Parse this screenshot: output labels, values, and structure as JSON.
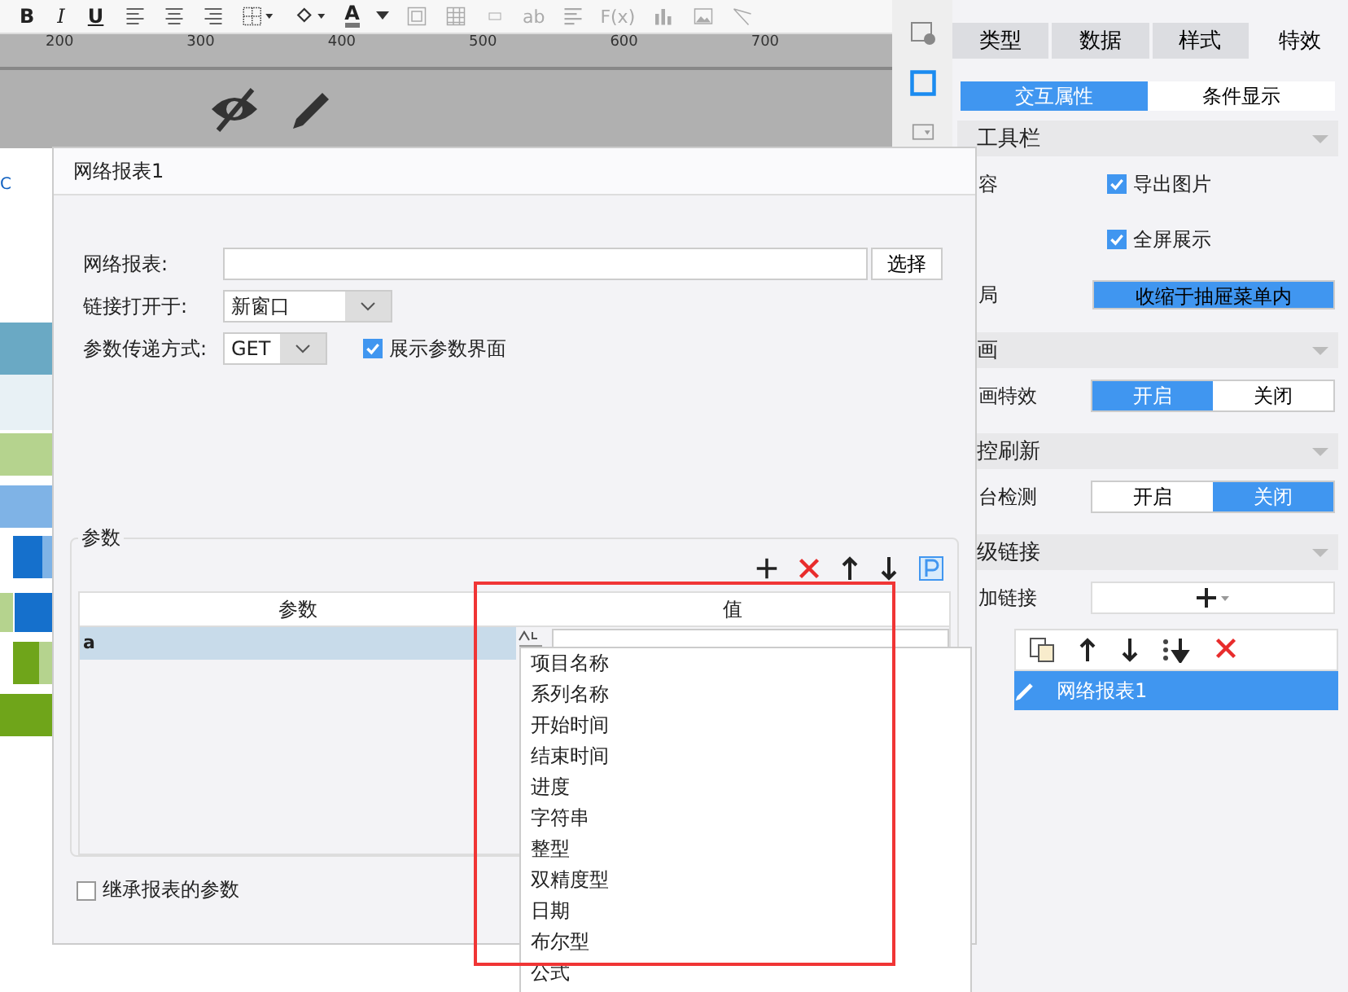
{
  "toolbar": {
    "format": [
      "B",
      "I",
      "U"
    ],
    "font_color": "A",
    "greyed_texts": [
      "ab",
      "F(x)"
    ]
  },
  "ruler": {
    "labels": [
      "200",
      "300",
      "400",
      "500",
      "600",
      "700"
    ]
  },
  "sheet": {
    "cell_text": "C"
  },
  "dialog": {
    "title": "网络报表1",
    "report_field": {
      "label": "网络报表:",
      "button": "选择"
    },
    "open_in": {
      "label": "链接打开于:",
      "value": "新窗口"
    },
    "method": {
      "label": "参数传递方式:",
      "value": "GET"
    },
    "show_params": {
      "label": "展示参数界面",
      "checked": true
    },
    "params": {
      "title": "参数",
      "columns": [
        "参数",
        "值"
      ],
      "rows": [
        {
          "name": "a",
          "selected": true
        }
      ]
    },
    "type_menu": [
      "项目名称",
      "系列名称",
      "开始时间",
      "结束时间",
      "进度",
      "字符串",
      "整型",
      "双精度型",
      "日期",
      "布尔型",
      "公式"
    ],
    "inherit": {
      "label": "继承报表的参数",
      "checked": false
    }
  },
  "panel": {
    "tabs": [
      {
        "label": "类型",
        "selected": false
      },
      {
        "label": "数据",
        "selected": false
      },
      {
        "label": "样式",
        "selected": false
      },
      {
        "label": "特效",
        "selected": true
      }
    ],
    "subtabs": [
      {
        "label": "交互属性",
        "selected": true
      },
      {
        "label": "条件显示",
        "selected": false
      }
    ],
    "sections": [
      {
        "title": "工具栏",
        "rows": [
          {
            "kind": "check",
            "label": "容",
            "option": "导出图片",
            "checked": true
          },
          {
            "kind": "check",
            "option": "全屏展示",
            "checked": true
          },
          {
            "kind": "button",
            "label": "局",
            "button": "收缩于抽屉菜单内"
          }
        ]
      },
      {
        "title": "画",
        "rows": [
          {
            "kind": "toggle",
            "label": "画特效",
            "options": [
              {
                "label": "开启",
                "selected": true
              },
              {
                "label": "关闭",
                "selected": false
              }
            ]
          }
        ]
      },
      {
        "title": "控刷新",
        "rows": [
          {
            "kind": "toggle",
            "label": "台检测",
            "options": [
              {
                "label": "开启",
                "selected": false
              },
              {
                "label": "关闭",
                "selected": true
              }
            ]
          }
        ]
      },
      {
        "title": "级链接",
        "rows": [
          {
            "kind": "add",
            "label": "加链接"
          }
        ]
      }
    ],
    "links": [
      {
        "label": "网络报表1",
        "selected": true
      }
    ]
  }
}
